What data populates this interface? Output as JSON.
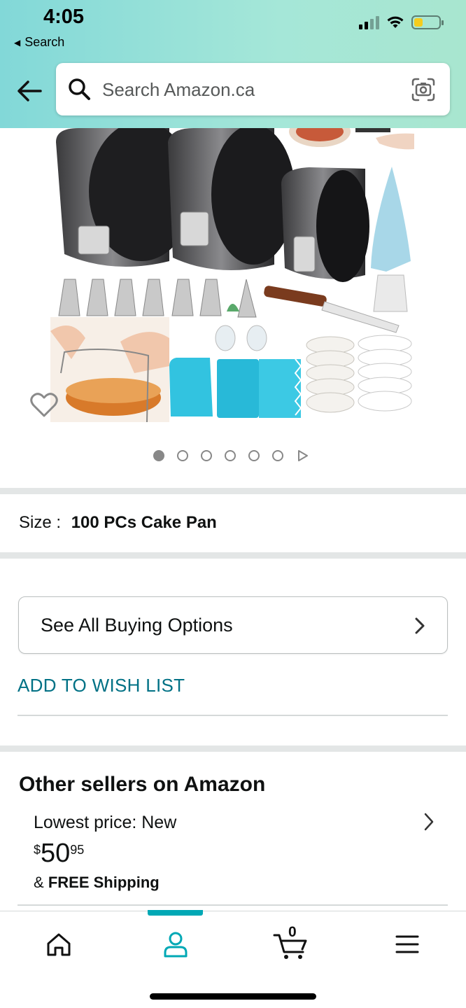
{
  "status_bar": {
    "time": "4:05",
    "back_app": "Search"
  },
  "search": {
    "placeholder": "Search Amazon.ca"
  },
  "product_image": {
    "alt": "Cake pan set with decorating tips, spatula, leveler, scrapers and cupcake liners",
    "carousel_pages": 6,
    "active_page": 1
  },
  "size": {
    "label": "Size :",
    "value": "100 PCs Cake Pan"
  },
  "buying_options": {
    "label": "See All Buying Options"
  },
  "wish_list": {
    "label": "ADD TO WISH LIST"
  },
  "other_sellers": {
    "title": "Other sellers on Amazon",
    "lowest_label": "Lowest price: New",
    "price_symbol": "$",
    "price_whole": "50",
    "price_fraction": "95",
    "shipping_prefix": "&",
    "shipping_bold": "FREE Shipping"
  },
  "bottom_nav": {
    "items": [
      "home",
      "account",
      "cart",
      "menu"
    ],
    "cart_count": "0",
    "active_item": "account"
  },
  "colors": {
    "header_gradient_start": "#82d8d8",
    "header_gradient_end": "#a8e6cf",
    "link": "#007185",
    "nav_accent": "#00a8b5"
  }
}
